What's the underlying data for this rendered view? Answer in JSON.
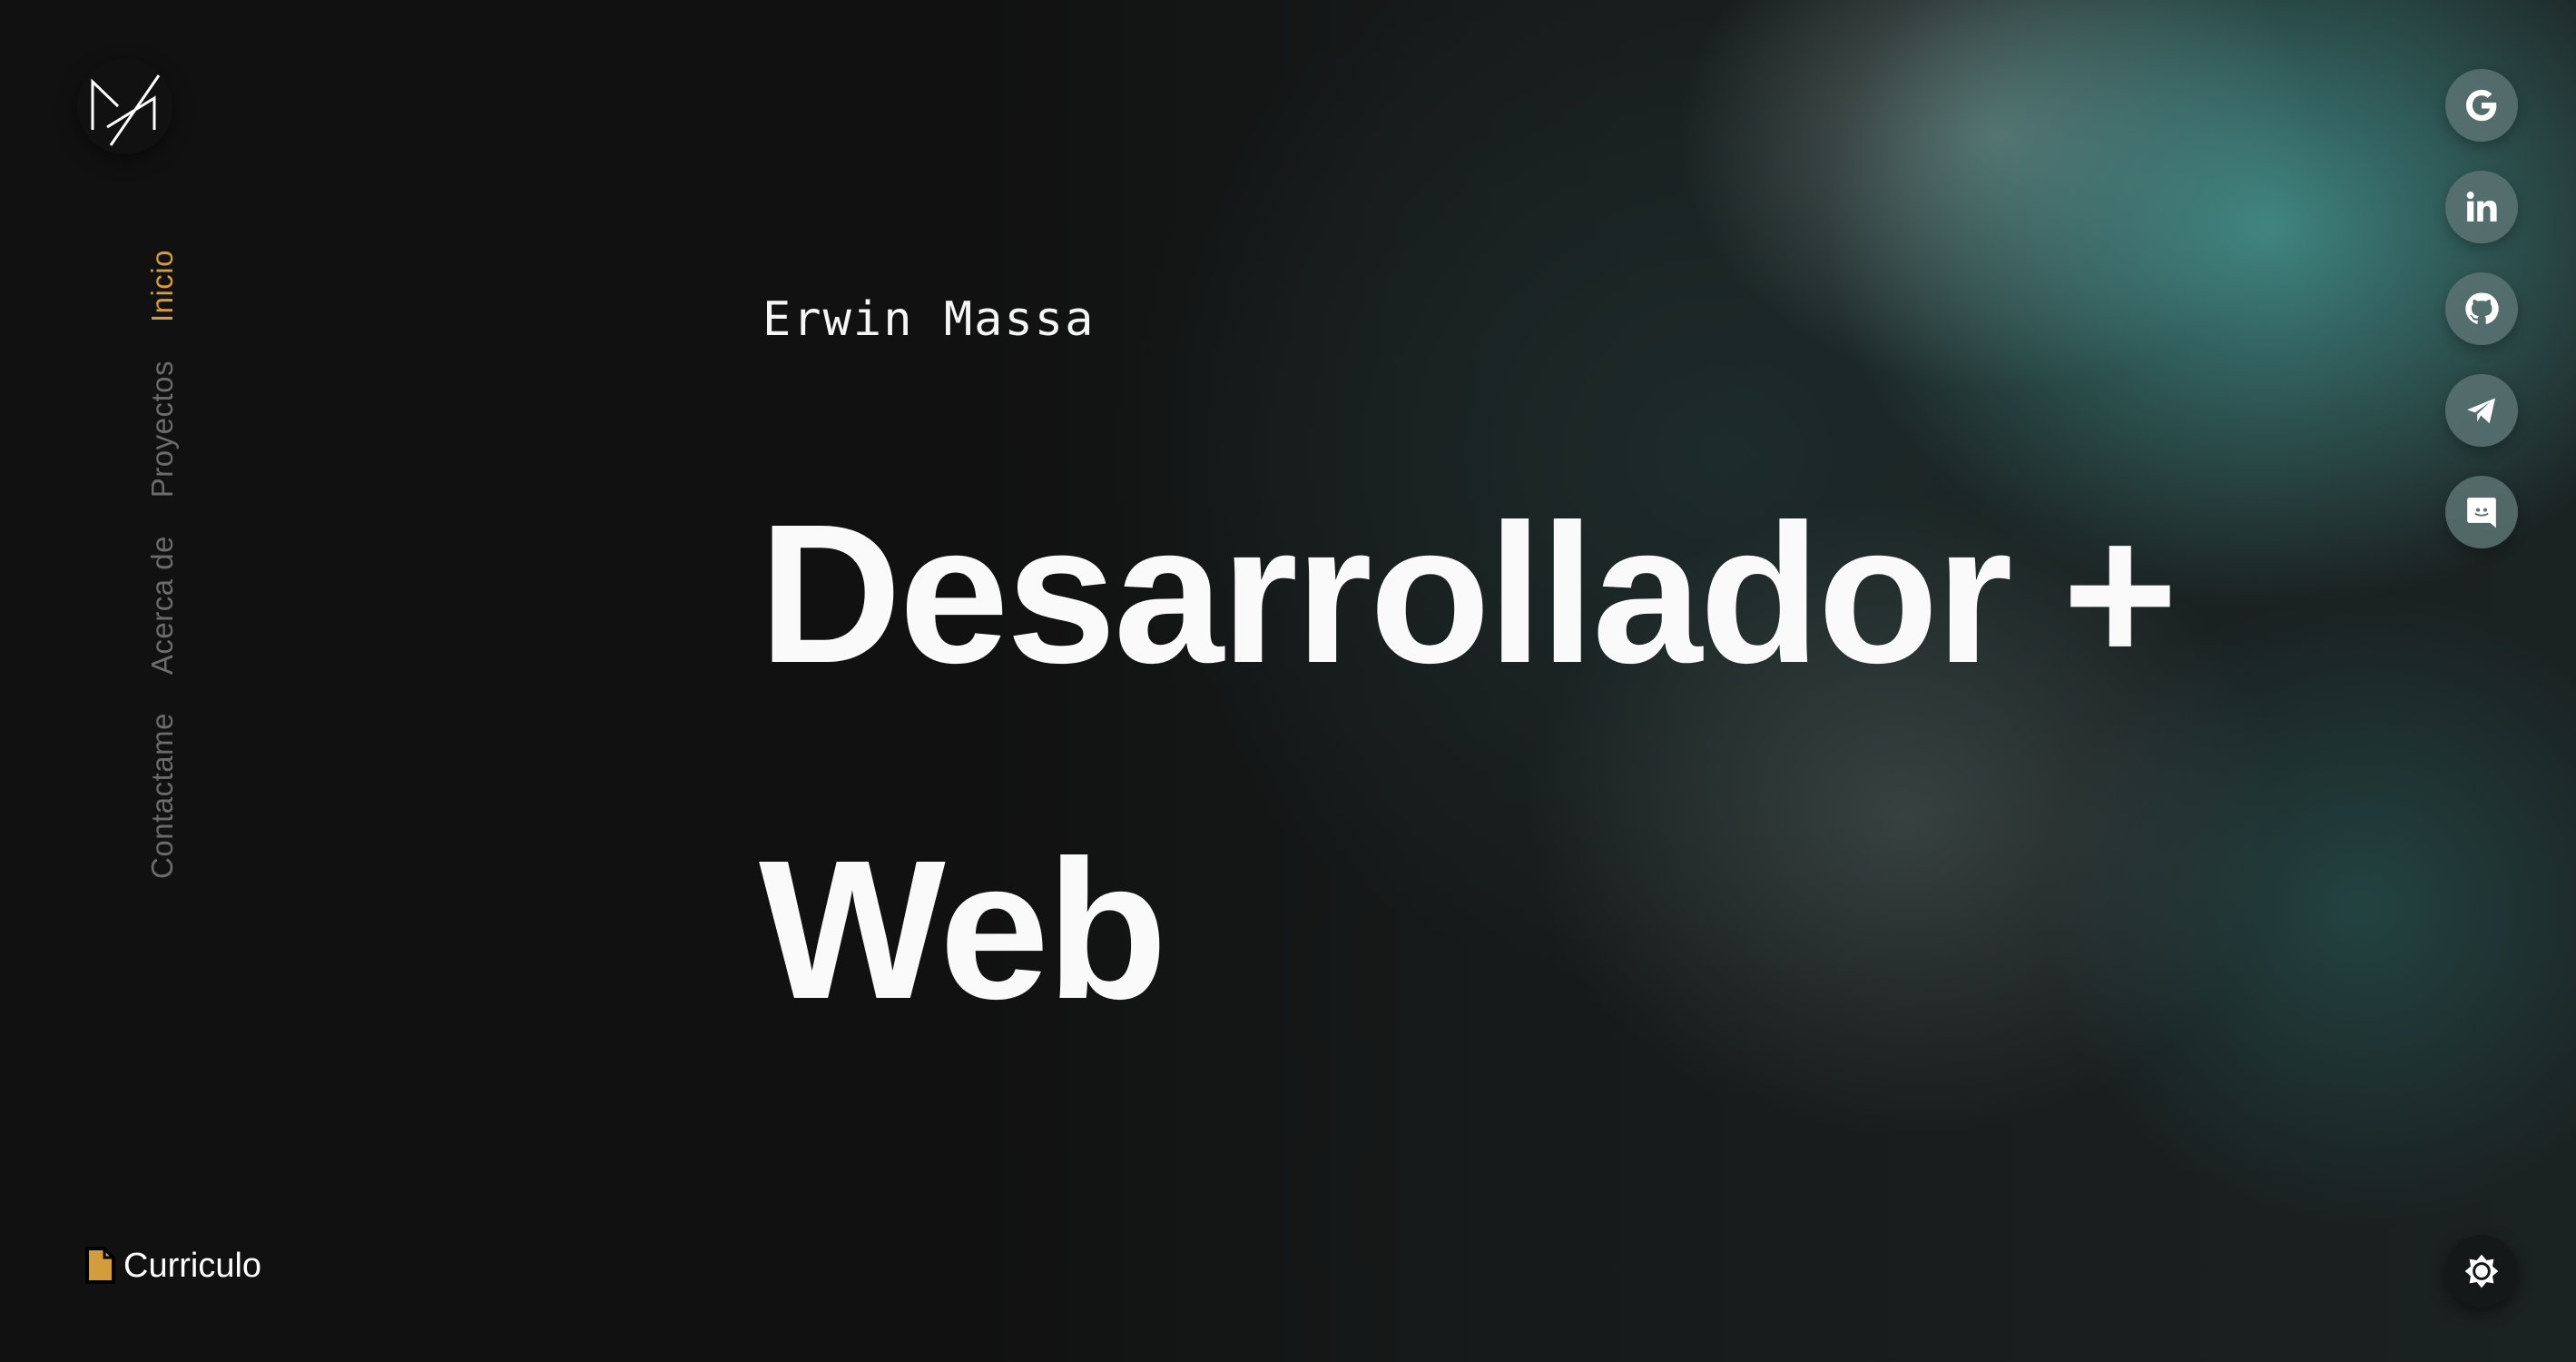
{
  "brand": {
    "logo_text": "M"
  },
  "nav": {
    "items": [
      {
        "label": "Inicio",
        "active": true
      },
      {
        "label": "Proyectos",
        "active": false
      },
      {
        "label": "Acerca de",
        "active": false
      },
      {
        "label": "Contactame",
        "active": false
      }
    ]
  },
  "resume": {
    "label": "Curriculo",
    "icon": "file-icon"
  },
  "hero": {
    "name": "Erwin Massa",
    "title_line1": "Desarrollador +",
    "title_line2": "Web"
  },
  "social": [
    {
      "icon": "google-icon"
    },
    {
      "icon": "linkedin-icon"
    },
    {
      "icon": "github-icon"
    },
    {
      "icon": "telegram-icon"
    },
    {
      "icon": "discord-icon"
    }
  ],
  "theme_toggle": {
    "icon": "sun-icon"
  },
  "colors": {
    "accent": "#d49d3c",
    "background": "#111111",
    "nav_inactive": "#6b6b6b"
  }
}
